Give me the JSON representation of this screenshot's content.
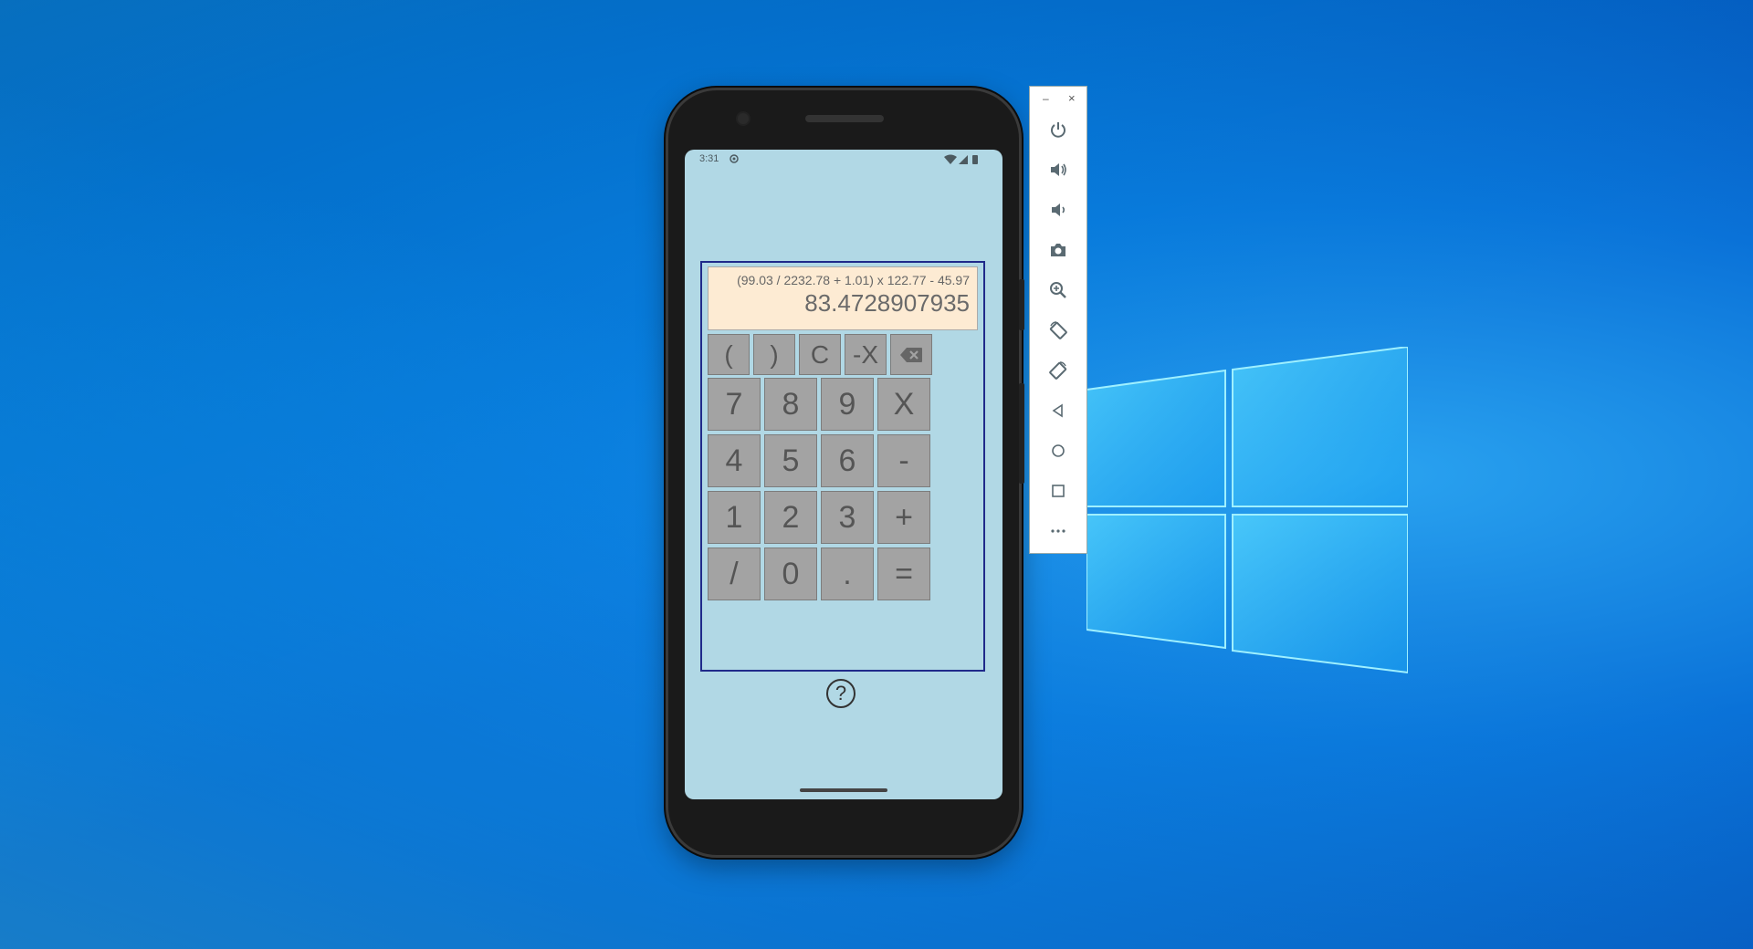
{
  "status_bar": {
    "time": "3:31"
  },
  "calculator": {
    "expression": "(99.03 / 2232.78 + 1.01) x 122.77 - 45.97",
    "result": "83.4728907935",
    "top_row": [
      "(",
      ")",
      "C",
      "-X"
    ],
    "backspace_icon": "backspace-icon",
    "keypad": [
      [
        "7",
        "8",
        "9",
        "X"
      ],
      [
        "4",
        "5",
        "6",
        "-"
      ],
      [
        "1",
        "2",
        "3",
        "+"
      ],
      [
        "/",
        "0",
        ".",
        "="
      ]
    ],
    "help_label": "?"
  },
  "emulator_toolbar": {
    "minimize_label": "–",
    "close_label": "×",
    "icons": [
      "power-icon",
      "volume-up-icon",
      "volume-down-icon",
      "camera-icon",
      "zoom-icon",
      "rotate-left-icon",
      "rotate-right-icon",
      "back-icon",
      "home-icon",
      "overview-icon",
      "more-icon"
    ]
  },
  "colors": {
    "screen_bg": "#b1d8e5",
    "display_bg": "#fdebd3",
    "key_bg": "#a3a3a3",
    "frame_border": "#1f2a8a"
  }
}
